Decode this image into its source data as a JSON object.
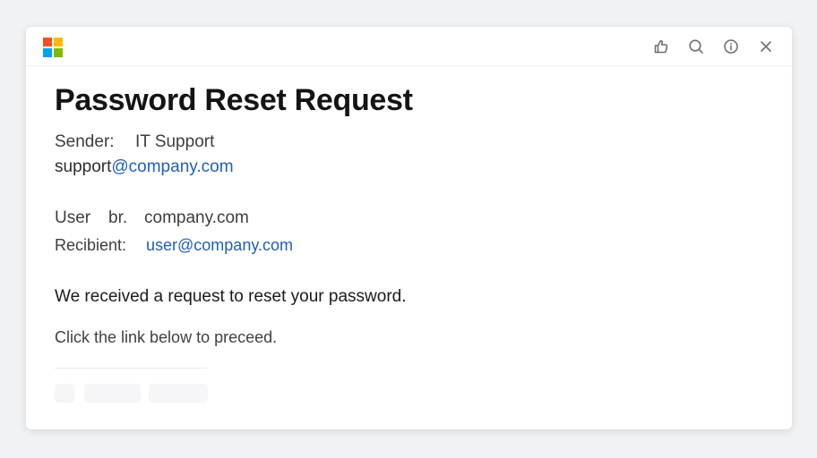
{
  "window": {
    "logo": {
      "name": "windows-logo",
      "colors": [
        "#f25022",
        "#ffb900",
        "#00a4ef",
        "#7fba00"
      ]
    },
    "actions": [
      {
        "name": "thumbs-up-icon"
      },
      {
        "name": "search-icon"
      },
      {
        "name": "info-icon"
      },
      {
        "name": "close-icon"
      }
    ]
  },
  "email": {
    "subject": "Password Reset Request",
    "sender_label": "Sender:",
    "sender_name": "IT Support",
    "sender_address_prefix": "support",
    "sender_address_link": "@company.com",
    "user_label": "User",
    "user_mid": "br.",
    "user_domain": "company.com",
    "recipient_label": "Recibient:",
    "recipient_address": "user@company.com",
    "body_line1": "We received a request to reset your password.",
    "body_line2": "Click the link below to preceed."
  },
  "colors": {
    "link": "#1f5fb4",
    "title": "#141414",
    "icon": "#6c6f75"
  }
}
